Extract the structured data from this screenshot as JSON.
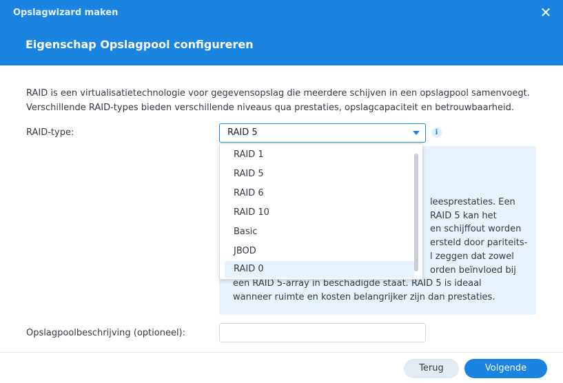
{
  "window": {
    "title": "Opslagwizard maken",
    "step_title": "Eigenschap Opslagpool configureren",
    "close_glyph": "✕"
  },
  "description": {
    "line1": "RAID is een virtualisatietechnologie voor gegevensopslag die meerdere schijven in een opslagpool samenvoegt.",
    "line2": "Verschillende RAID-types bieden verschillende niveaus qua prestaties, opslagcapaciteit en betrouwbaarheid."
  },
  "raid": {
    "label": "RAID-type:",
    "selected": "RAID 5",
    "info_glyph": "i",
    "options": [
      "RAID 1",
      "RAID 5",
      "RAID 6",
      "RAID 10",
      "Basic",
      "JBOD",
      "RAID 0"
    ],
    "highlighted_index": 6
  },
  "info_box": {
    "lines": [
      "leesprestaties. Een",
      "RAID 5 kan het",
      "en schijffout worden",
      "ersteld door pariteits-",
      "l zeggen dat zowel",
      "orden beïnvloed bij",
      "een RAID 5-array in beschadigde staat. RAID 5 is ideaal",
      "wanneer ruimte en kosten belangrijker zijn dan prestaties."
    ]
  },
  "description_field": {
    "label": "Opslagpoolbeschrijving (optioneel):",
    "value": "",
    "placeholder": ""
  },
  "footer": {
    "back_label": "Terug",
    "next_label": "Volgende"
  },
  "colors": {
    "accent": "#1a84e0",
    "info_bg": "#e8f2fc"
  }
}
